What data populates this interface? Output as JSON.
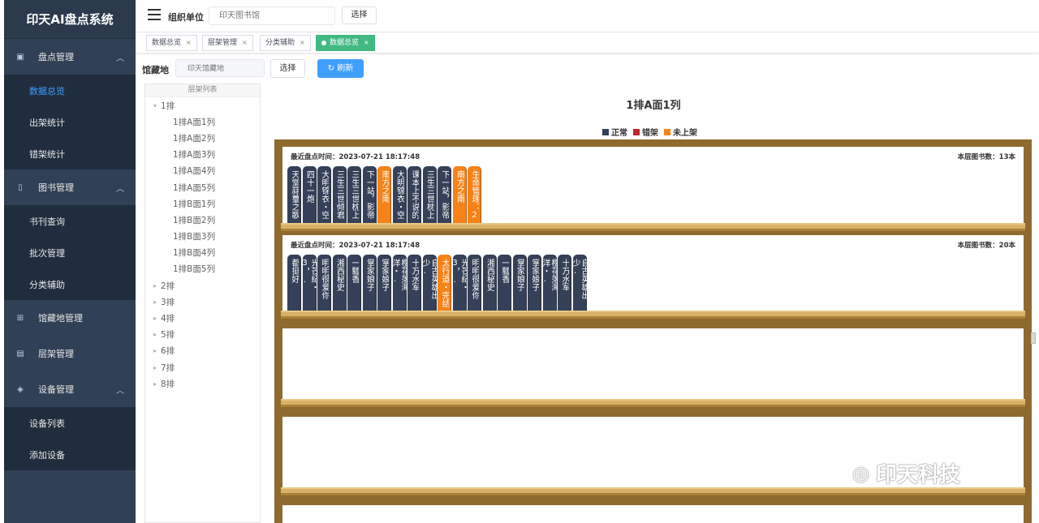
{
  "sidebar": {
    "title": "印天AI盘点系统",
    "groups": [
      {
        "label": "盘点管理",
        "children": [
          "数据总览",
          "出架统计",
          "错架统计"
        ]
      },
      {
        "label": "图书管理",
        "children": [
          "书刊查询",
          "批次管理",
          "分类辅助"
        ]
      },
      {
        "label": "馆藏地管理"
      },
      {
        "label": "层架管理"
      },
      {
        "label": "设备管理",
        "children": [
          "设备列表",
          "添加设备"
        ]
      }
    ]
  },
  "topbar": {
    "org_label": "组织单位",
    "org_placeholder": "印天图书馆",
    "select_label": "选择"
  },
  "tags": [
    {
      "label": "数据总览"
    },
    {
      "label": "层架管理"
    },
    {
      "label": "分类辅助"
    },
    {
      "label": "数据总览",
      "active": true
    }
  ],
  "filter": {
    "lib_label": "馆藏地",
    "lib_placeholder": "印天馆藏地",
    "select_label": "选择",
    "refresh_label": "刷新"
  },
  "tree": {
    "header": "层架列表",
    "root_expanded": "1排",
    "children": [
      "1排A面1列",
      "1排A面2列",
      "1排A面3列",
      "1排A面4列",
      "1排A面5列",
      "1排B面1列",
      "1排B面2列",
      "1排B面3列",
      "1排B面4列",
      "1排B面5列"
    ],
    "collapsed": [
      "2排",
      "3排",
      "4排",
      "5排",
      "6排",
      "7排",
      "8排"
    ]
  },
  "main": {
    "title": "1排A面1列",
    "legend": [
      {
        "label": "正常",
        "color": "#354158"
      },
      {
        "label": "错架",
        "color": "#c0272d"
      },
      {
        "label": "未上架",
        "color": "#f68218"
      }
    ],
    "shelves": [
      {
        "check_time": "最近盘点时间：2023-07-21 18:17:48",
        "book_count": "本层图书数：13本",
        "books": [
          {
            "title": "天堂蒜薹之歌",
            "status": "normal"
          },
          {
            "title": "四十一炮",
            "status": "normal"
          },
          {
            "title": "大明锦衣・空.",
            "status": "normal"
          },
          {
            "title": "三生三世倾君.",
            "status": "normal"
          },
          {
            "title": "三生三世枕上.",
            "status": "normal"
          },
          {
            "title": "下一站，影帝",
            "status": "normal"
          },
          {
            "title": "南方之南",
            "status": "unshelved"
          },
          {
            "title": "大明锦衣・空.",
            "status": "normal"
          },
          {
            "title": "课本上不说的.",
            "status": "normal"
          },
          {
            "title": "三生三世枕上.",
            "status": "normal"
          },
          {
            "title": "下一站，影帝",
            "status": "normal"
          },
          {
            "title": "南方之南",
            "status": "unshelved"
          },
          {
            "title": "生命管理：2",
            "status": "unshelved"
          }
        ]
      },
      {
        "check_time": "最近盘点时间：2023-07-21 18:17:48",
        "book_count": "本层图书数：20本",
        "books": [
          {
            "title": "都挺好",
            "status": "normal"
          },
          {
            "title": "光芒纪・3，.",
            "status": "normal"
          },
          {
            "title": "明明很爱你",
            "status": "normal"
          },
          {
            "title": "湘西秘史",
            "status": "normal"
          },
          {
            "title": "一瓢香",
            "status": "normal"
          },
          {
            "title": "掌家娘子",
            "status": "normal"
          },
          {
            "title": "掌家娘子",
            "status": "normal"
          },
          {
            "title": "樱花落海洋・.",
            "status": "normal"
          },
          {
            "title": "十万水军",
            "status": "normal"
          },
          {
            "title": "自古英雄出少.",
            "status": "normal"
          },
          {
            "title": "太行道・完结",
            "status": "unshelved"
          },
          {
            "title": "光芒纪・3，.",
            "status": "normal"
          },
          {
            "title": "明明很爱你",
            "status": "normal"
          },
          {
            "title": "湘西秘史",
            "status": "normal"
          },
          {
            "title": "一瓢香",
            "status": "normal"
          },
          {
            "title": "掌家娘子",
            "status": "normal"
          },
          {
            "title": "掌家娘子",
            "status": "normal"
          },
          {
            "title": "樱花落海洋・.",
            "status": "normal"
          },
          {
            "title": "十万水军",
            "status": "normal"
          },
          {
            "title": "自古英雄出少.",
            "status": "normal"
          }
        ]
      },
      {
        "books": []
      },
      {
        "books": []
      },
      {
        "books": []
      }
    ]
  },
  "watermark": "印天科技"
}
